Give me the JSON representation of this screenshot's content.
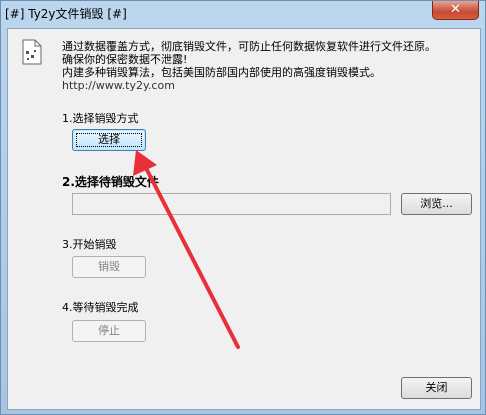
{
  "window": {
    "title": "[#] Ty2y文件销毁 [#]",
    "close_glyph": "✕"
  },
  "intro": {
    "lines": [
      "通过数据覆盖方式，彻底销毁文件，可防止任何数据恢复软件进行文件还原。",
      "确保你的保密数据不泄露!",
      "内建多种销毁算法，包括美国防部国内部使用的高强度销毁模式。",
      "http://www.ty2y.com"
    ]
  },
  "steps": {
    "step1_label": "1.选择销毁方式",
    "step1_button": "选择",
    "step2_label": "2.选择待销毁文件",
    "step2_input_value": "",
    "step2_button": "浏览...",
    "step3_label": "3.开始销毁",
    "step3_button": "销毁",
    "step4_label": "4.等待销毁完成",
    "step4_button": "停止"
  },
  "footer": {
    "close_button": "关闭"
  },
  "annotation": {
    "arrow_color": "#e8303a"
  }
}
